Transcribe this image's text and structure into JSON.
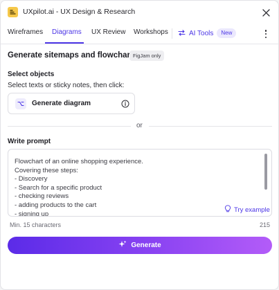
{
  "window": {
    "title": "UXpilot.ai - UX Design & Research"
  },
  "tabs": [
    {
      "label": "Wireframes",
      "active": false
    },
    {
      "label": "Diagrams",
      "active": true
    },
    {
      "label": "UX Review",
      "active": false
    },
    {
      "label": "Workshops",
      "active": false
    }
  ],
  "ai_tools": {
    "label": "AI Tools",
    "badge": "New"
  },
  "header": {
    "title": "Generate sitemaps and flowcharts",
    "badge": "FigJam only"
  },
  "select_objects": {
    "title": "Select objects",
    "description": "Select texts or sticky notes, then click:",
    "button_label": "Generate diagram"
  },
  "divider": {
    "label": "or"
  },
  "prompt": {
    "title": "Write prompt",
    "value": "Flowchart of an online shopping experience.\nCovering these steps:\n- Discovery\n- Search for a specific product\n- checking reviews\n- adding products to the cart\n- signing up",
    "try_example_label": "Try example",
    "min_chars_label": "Min. 15 characters",
    "char_count": "215"
  },
  "generate_button": {
    "label": "Generate"
  },
  "colors": {
    "accent": "#4b35e6",
    "logo": "#f6c84a",
    "button_gradient_start": "#5b2be8",
    "button_gradient_end": "#b35cf8"
  },
  "icons": {
    "logo": "uxpilot-logo",
    "close": "close-icon",
    "ai_tools": "swap-arrows-icon",
    "more": "more-vertical-icon",
    "generate_diagram": "diagram-icon",
    "info": "info-icon",
    "try_example": "lightbulb-icon",
    "generate": "sparkle-icon"
  }
}
